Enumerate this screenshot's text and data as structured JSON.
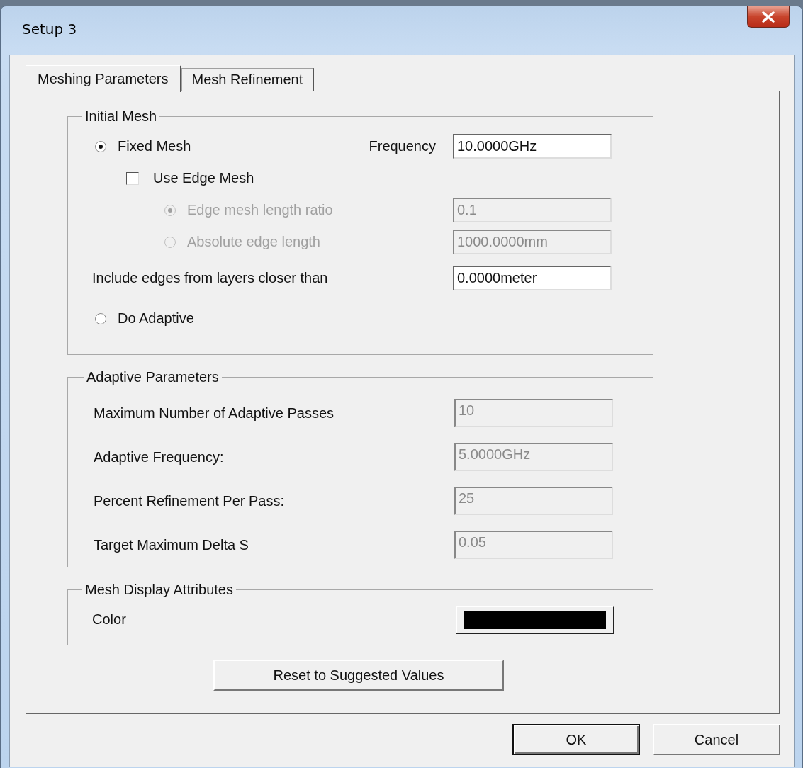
{
  "window": {
    "title": "Setup 3"
  },
  "tabs": [
    {
      "label": "Meshing Parameters",
      "selected": true
    },
    {
      "label": "Mesh Refinement",
      "selected": false
    }
  ],
  "initial_mesh": {
    "title": "Initial Mesh",
    "fixed_mesh": {
      "label": "Fixed Mesh",
      "selected": true
    },
    "frequency": {
      "label": "Frequency",
      "value": "10.0000GHz"
    },
    "use_edge_mesh": {
      "label": "Use Edge Mesh",
      "checked": false
    },
    "edge_options": [
      {
        "label": "Edge mesh length ratio",
        "selected": true,
        "disabled": true,
        "value": "0.1"
      },
      {
        "label": "Absolute edge length",
        "selected": false,
        "disabled": true,
        "value": "1000.0000mm"
      }
    ],
    "include_edges": {
      "label": "Include edges from layers closer than",
      "value": "0.0000meter"
    },
    "do_adaptive": {
      "label": "Do Adaptive",
      "selected": false
    }
  },
  "adaptive_parameters": {
    "title": "Adaptive Parameters",
    "fields": [
      {
        "label": "Maximum Number of Adaptive Passes",
        "value": "10",
        "disabled": true
      },
      {
        "label": "Adaptive Frequency:",
        "value": "5.0000GHz",
        "disabled": true
      },
      {
        "label": "Percent Refinement Per Pass:",
        "value": "25",
        "disabled": true
      },
      {
        "label": "Target Maximum Delta S",
        "value": "0.05",
        "disabled": true
      }
    ]
  },
  "mesh_display": {
    "title": "Mesh Display Attributes",
    "color_label": "Color",
    "color": "#000000"
  },
  "reset_button": "Reset to Suggested Values",
  "buttons": [
    {
      "label": "OK",
      "default": true
    },
    {
      "label": "Cancel",
      "default": false
    }
  ]
}
